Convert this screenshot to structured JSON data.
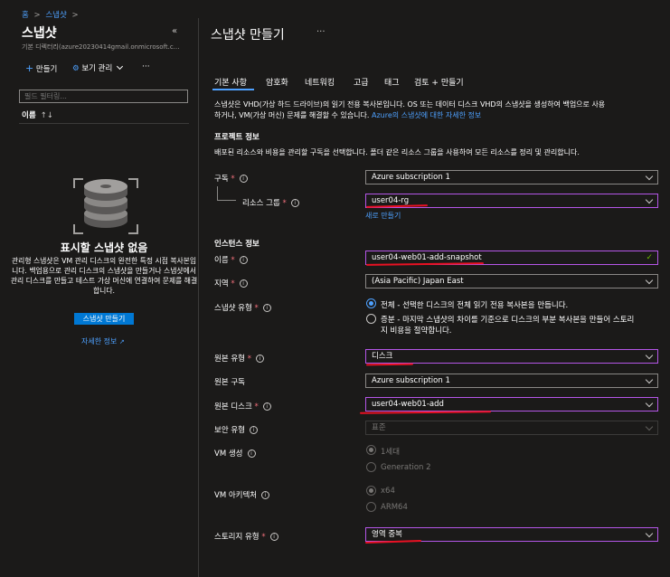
{
  "breadcrumb": {
    "home": "홈",
    "sep": ">",
    "current": "스냅샷",
    "sep2": ">"
  },
  "left_panel": {
    "title": "스냅샷",
    "subtitle": "기본 디렉터리(azure20230414gmail.onmicrosoft.c...",
    "create_label": "만들기",
    "view_label": "보기 관리",
    "more": "···",
    "filter_placeholder": "필드 필터링...",
    "column_name": "이름",
    "sort_arrows": "↑↓",
    "empty_title": "표시할 스냅샷 없음",
    "empty_desc": "관리형 스냅샷은 VM 관리 디스크의 완전한 특정 시점 복사본입니다. 백업용으로 관리 디스크의 스냅샷을 만들거나 스냅샷에서 관리 디스크를 만들고 테스트 가상 머신에 연결하여 문제를 해결합니다.",
    "create_button": "스냅샷 만들기",
    "learn_more": "자세한 정보"
  },
  "main": {
    "title": "스냅샷 만들기",
    "more": "···",
    "tabs": [
      {
        "label": "기본 사항"
      },
      {
        "label": "암호화"
      },
      {
        "label": "네트워킹"
      },
      {
        "label": "고급"
      },
      {
        "label": "태그"
      },
      {
        "label": "검토 + 만들기"
      }
    ],
    "intro_line1": "스냅샷은 VHD(가상 하드 드라이브)의 읽기 전용 복사본입니다. OS 또는 데이터 디스크 VHD의 스냅샷을 생성하여 백업으로 사용",
    "intro_line2": "하거나, VM(가상 머신) 문제를 해결할 수 있습니다.",
    "intro_link": "Azure의 스냅샷에 대한 자세한 정보",
    "project_heading": "프로젝트 정보",
    "project_desc": "배포된 리소스와 비용을 관리할 구독을 선택합니다. 폴더 같은 리소스 그룹을 사용하여 모든 리소스를 정리 및 관리합니다.",
    "subscription_label": "구독",
    "subscription_value": "Azure subscription 1",
    "rg_label": "리소스 그룹",
    "rg_value": "user04-rg",
    "rg_new": "새로 만들기",
    "instance_heading": "인스턴스 정보",
    "name_label": "이름",
    "name_value": "user04-web01-add-snapshot",
    "region_label": "지역",
    "region_value": "(Asia Pacific) Japan East",
    "snapshot_type_label": "스냅샷 유형",
    "snapshot_type_full": "전체 - 선택한 디스크의 전체 읽기 전용 복사본을 만듭니다.",
    "snapshot_type_incr1": "증분 - 마지막 스냅샷의 차이를 기준으로 디스크의 부분 복사본을 만들어 스토리",
    "snapshot_type_incr2": "지 비용을 절약합니다.",
    "source_type_label": "원본 유형",
    "source_type_value": "디스크",
    "source_sub_label": "원본 구독",
    "source_sub_value": "Azure subscription 1",
    "source_disk_label": "원본 디스크",
    "source_disk_value": "user04-web01-add",
    "security_label": "보안 유형",
    "security_value": "표준",
    "vmgen_label": "VM 생성",
    "vmgen_opt1": "1세대",
    "vmgen_opt2": "Generation 2",
    "vmarch_label": "VM 아키텍처",
    "vmarch_opt1": "x64",
    "vmarch_opt2": "ARM64",
    "storage_label": "스토리지 유형",
    "storage_value": "영역 중복",
    "req_mark": "*",
    "info_mark": "i",
    "check_mark": "✓"
  },
  "colors": {
    "accent": "#4ea1ff",
    "highlight": "#b556e8",
    "annotation": "#e81123",
    "button": "#0078d4"
  }
}
